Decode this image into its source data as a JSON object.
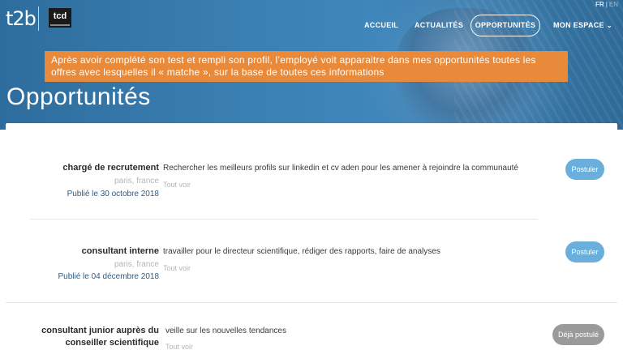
{
  "header": {
    "logo_left": "t2b",
    "logo_right": "tcd",
    "lang_active": "FR",
    "lang_inactive": "EN",
    "nav": [
      {
        "label": "ACCUEIL"
      },
      {
        "label": "ACTUALITÉS"
      },
      {
        "label": "OPPORTUNITÉS"
      },
      {
        "label": "MON ESPACE"
      }
    ]
  },
  "banner": {
    "text": "Après avoir complété son test et rempli son profil, l’employé voit apparaitre dans mes opportunités toutes les offres avec lesquelles il « matche », sur la base de toutes ces informations"
  },
  "page": {
    "title": "Opportunités"
  },
  "offers": [
    {
      "title": "chargé de recrutement",
      "location": "paris, france",
      "date": "Publié le 30 octobre 2018",
      "description": "Rechercher les meilleurs profils sur linkedin et cv aden pour les amener à rejoindre la communauté",
      "more": "Tout voir",
      "button": "Postuler",
      "status": "apply"
    },
    {
      "title": "consultant interne",
      "location": "paris, france",
      "date": "Publié le 04 décembre 2018",
      "description": "travailler pour le directeur scientifique, rédiger des rapports, faire de analyses",
      "more": "Tout voir",
      "button": "Postuler",
      "status": "apply"
    },
    {
      "title": "consultant junior auprès du conseiller scientifique",
      "location": "",
      "date": "",
      "description": "veille sur les nouvelles tendances",
      "more": "Tout voir",
      "button": "Déjà postulé",
      "status": "applied"
    }
  ],
  "colors": {
    "banner": "#e98a3b",
    "apply_button": "#6aaedc",
    "applied_button": "#9a9a9a",
    "date_text": "#2c5a86"
  }
}
